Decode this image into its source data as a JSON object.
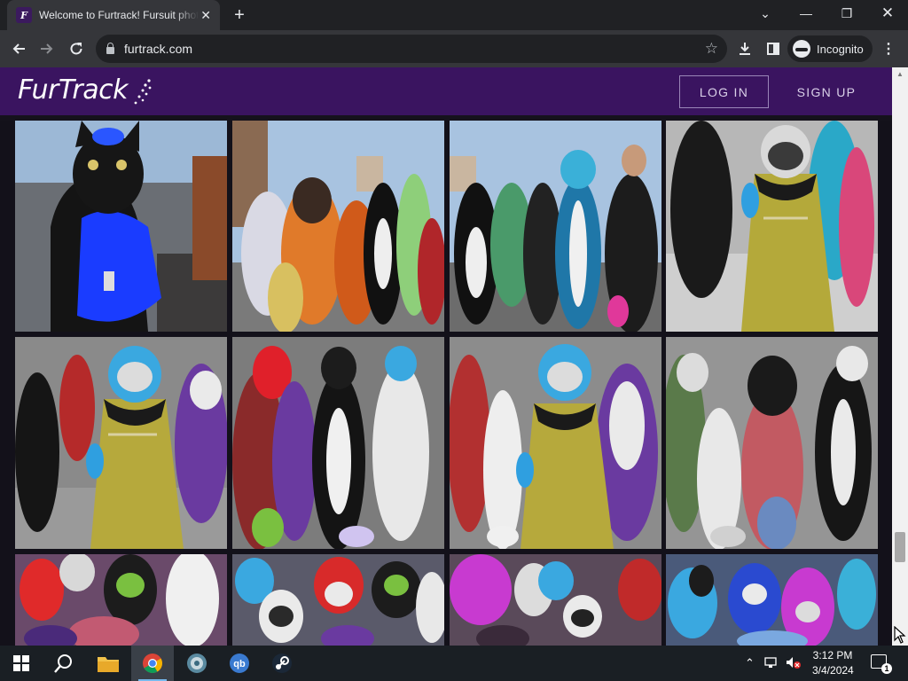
{
  "browser": {
    "tab_title": "Welcome to Furtrack! Fursuit photos",
    "tab_favicon": "F",
    "url": "furtrack.com",
    "profile_label": "Incognito"
  },
  "site": {
    "logo_text": "FurTrack",
    "login_label": "LOG IN",
    "signup_label": "SIGN UP"
  },
  "gallery": {
    "photos": [
      {
        "name": "photo-blue-black-fursuit"
      },
      {
        "name": "photo-orange-group"
      },
      {
        "name": "photo-teal-group"
      },
      {
        "name": "photo-yellow-robe-fursuit"
      },
      {
        "name": "photo-yellow-robe-group"
      },
      {
        "name": "photo-black-white-group"
      },
      {
        "name": "photo-yellow-robe-crowd"
      },
      {
        "name": "photo-pink-shirt-fursuit"
      },
      {
        "name": "photo-red-hair-crowd"
      },
      {
        "name": "photo-raccoon-crowd"
      },
      {
        "name": "photo-magenta-crowd"
      },
      {
        "name": "photo-blue-purple-crowd"
      }
    ]
  },
  "taskbar": {
    "time": "3:12 PM",
    "date": "3/4/2024",
    "notification_count": "1"
  },
  "colors": {
    "site_header": "#3a1460",
    "page_background": "#13111a"
  }
}
